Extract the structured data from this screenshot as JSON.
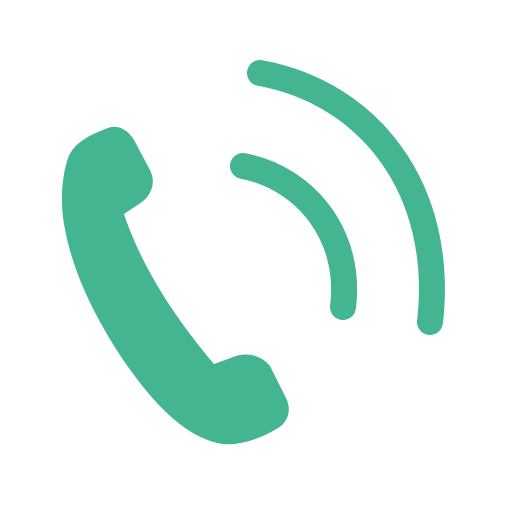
{
  "icon": {
    "name": "phone-ringing-icon",
    "color": "#43B591",
    "background": "#FFFFFF"
  }
}
